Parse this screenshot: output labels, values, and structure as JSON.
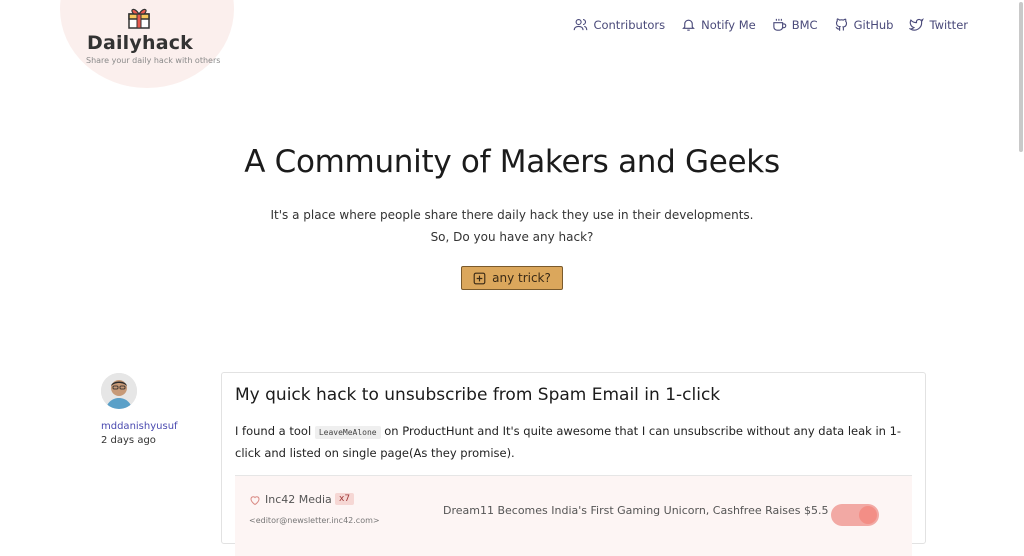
{
  "brand": {
    "title": "Dailyhack",
    "tagline": "Share your daily hack with others",
    "icon": "gift-box-icon"
  },
  "nav": [
    {
      "label": "Contributors",
      "icon": "users-icon"
    },
    {
      "label": "Notify Me",
      "icon": "bell-icon"
    },
    {
      "label": "BMC",
      "icon": "coffee-icon"
    },
    {
      "label": "GitHub",
      "icon": "github-icon"
    },
    {
      "label": "Twitter",
      "icon": "twitter-icon"
    }
  ],
  "hero": {
    "title": "A Community of Makers and Geeks",
    "line1": "It's a place where people share there daily hack they use in their developments.",
    "line2": "So, Do you have any hack?",
    "cta_label": "any trick?",
    "cta_icon": "plus-square-icon"
  },
  "post": {
    "author": "mddanishyusuf",
    "time": "2 days ago",
    "title": "My quick hack to unsubscribe from Spam Email in 1-click",
    "body_pre": "I found a tool ",
    "body_code": "LeaveMeAlone",
    "body_post": " on ProductHunt and It's quite awesome that I can unsubscribe without any data leak in 1-click and listed on single page(As they promise).",
    "preview": {
      "sender": "Inc42 Media",
      "badge": "x7",
      "email": "<editor@newsletter.inc42.com>",
      "subject": "Dream11 Becomes India's First Gaming Unicorn, Cashfree Raises $5.5"
    }
  },
  "colors": {
    "accent": "#dba75c",
    "blob": "#fbefed",
    "nav_text": "#4a4a7a",
    "author_link": "#4a4ab0"
  }
}
